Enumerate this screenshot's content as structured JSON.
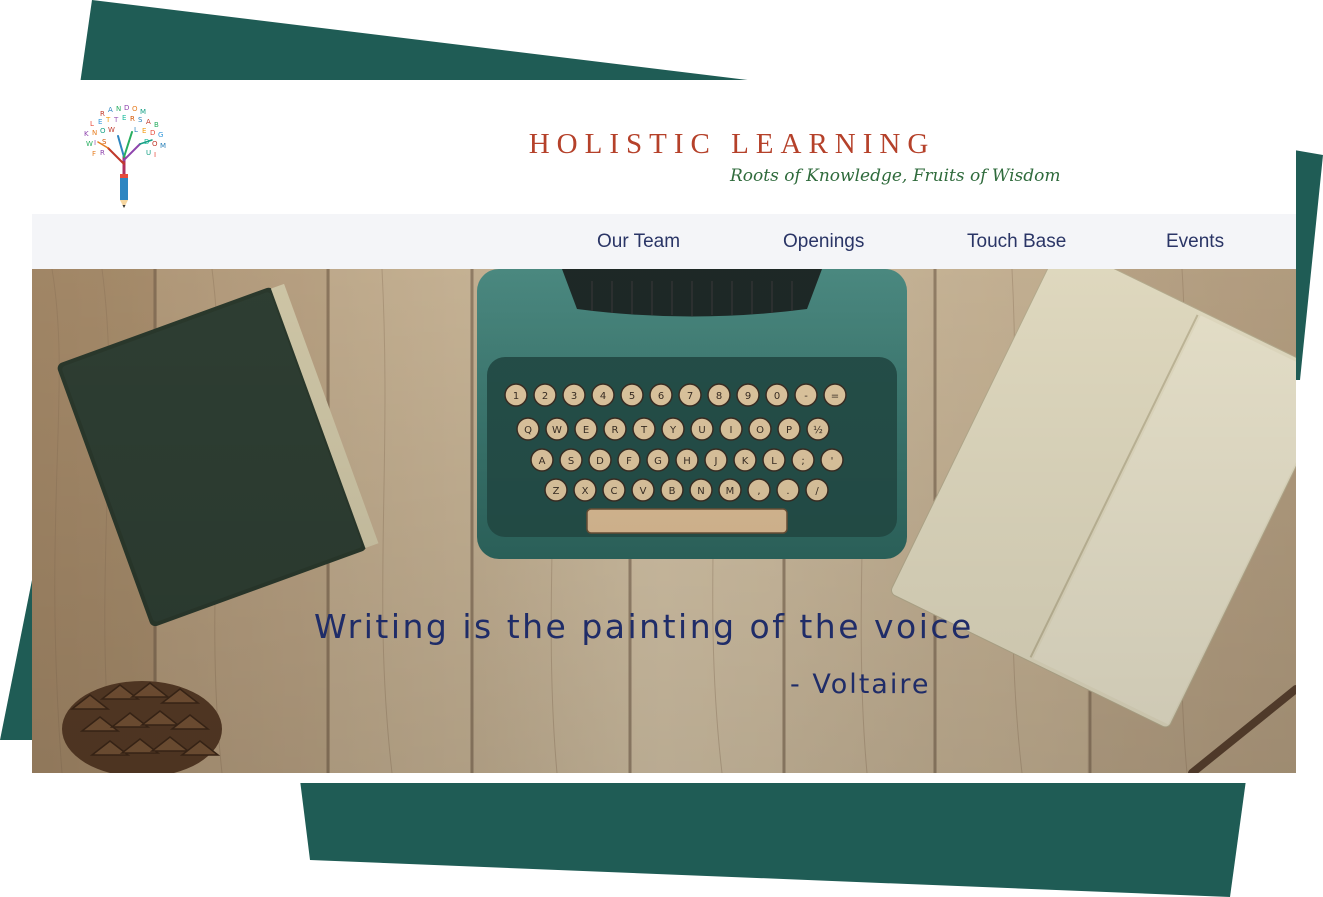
{
  "site": {
    "title": "HOLISTIC LEARNING",
    "tagline": "Roots of Knowledge, Fruits of Wisdom"
  },
  "nav": {
    "items": [
      {
        "label": "Our Team"
      },
      {
        "label": "Openings"
      },
      {
        "label": "Touch Base"
      },
      {
        "label": "Events"
      }
    ]
  },
  "hero": {
    "quote": "Writing is the painting of the voice",
    "author": "- Voltaire",
    "typewriter_key_rows": [
      [
        "1",
        "2",
        "3",
        "4",
        "5",
        "6",
        "7",
        "8",
        "9",
        "0",
        "-",
        "="
      ],
      [
        "Q",
        "W",
        "E",
        "R",
        "T",
        "Y",
        "U",
        "I",
        "O",
        "P",
        "½"
      ],
      [
        "A",
        "S",
        "D",
        "F",
        "G",
        "H",
        "J",
        "K",
        "L",
        ";",
        "'"
      ],
      [
        "Z",
        "X",
        "C",
        "V",
        "B",
        "N",
        "M",
        ",",
        ".",
        "/"
      ]
    ]
  },
  "colors": {
    "accent_teal": "#1f5c55",
    "title_red": "#b5412a",
    "tagline_green": "#2f6b3c",
    "nav_text": "#2a3566",
    "quote_text": "#1f2c68"
  }
}
